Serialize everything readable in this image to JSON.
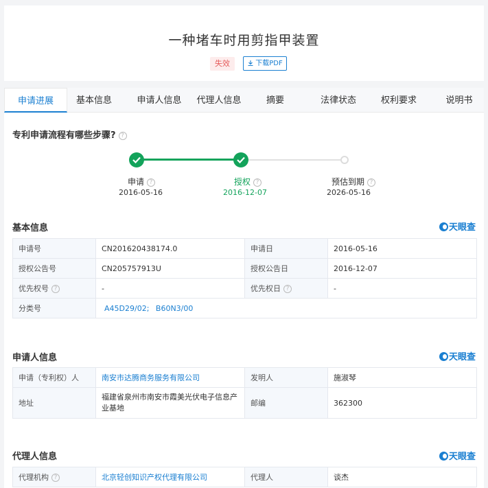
{
  "header": {
    "title": "一种堵车时用剪指甲装置",
    "status": "失效",
    "download_label": "下载PDF"
  },
  "tabs": [
    "申请进展",
    "基本信息",
    "申请人信息",
    "代理人信息",
    "摘要",
    "法律状态",
    "权利要求",
    "说明书"
  ],
  "process": {
    "heading": "专利申请流程有哪些步骤?",
    "steps": [
      {
        "label": "申请",
        "date": "2016-05-16",
        "state": "done"
      },
      {
        "label": "授权",
        "date": "2016-12-07",
        "state": "current"
      },
      {
        "label": "预估到期",
        "date": "2026-05-16",
        "state": "pending"
      }
    ]
  },
  "brand": "天眼查",
  "basic_info": {
    "heading": "基本信息",
    "application_no_label": "申请号",
    "application_no": "CN201620438174.0",
    "application_date_label": "申请日",
    "application_date": "2016-05-16",
    "grant_pub_no_label": "授权公告号",
    "grant_pub_no": "CN205757913U",
    "grant_pub_date_label": "授权公告日",
    "grant_pub_date": "2016-12-07",
    "priority_no_label": "优先权号",
    "priority_no": "-",
    "priority_date_label": "优先权日",
    "priority_date": "-",
    "classification_label": "分类号",
    "classification_1": "A45D29/02;",
    "classification_2": "B60N3/00"
  },
  "applicant_info": {
    "heading": "申请人信息",
    "applicant_label": "申请（专利权）人",
    "applicant": "南安市达腾商务服务有限公司",
    "inventor_label": "发明人",
    "inventor": "施淑琴",
    "address_label": "地址",
    "address": "福建省泉州市南安市霞美光伏电子信息产业基地",
    "postcode_label": "邮编",
    "postcode": "362300"
  },
  "agent_info": {
    "heading": "代理人信息",
    "agency_label": "代理机构",
    "agency": "北京轻创知识产权代理有限公司",
    "agent_label": "代理人",
    "agent": "谈杰"
  },
  "colors": {
    "accent": "#1a7fd1",
    "success": "#13a35b",
    "invalid": "#e55b5b"
  }
}
